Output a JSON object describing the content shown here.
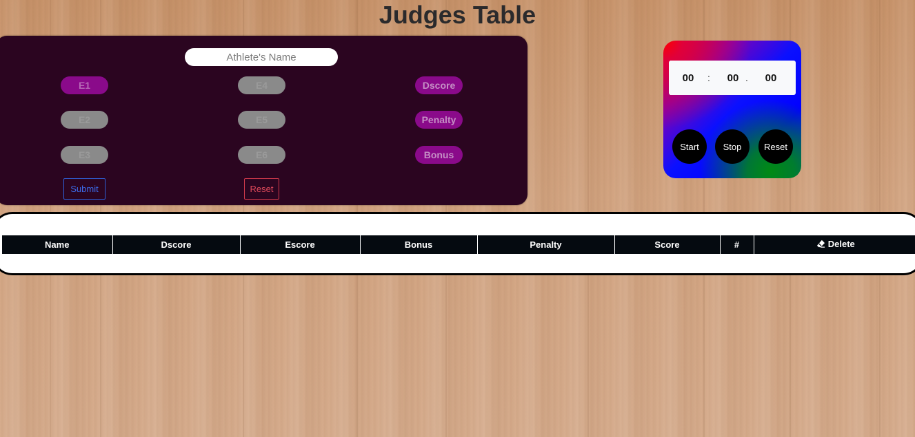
{
  "page": {
    "title": "Judges Table"
  },
  "judges_panel": {
    "athlete_name_placeholder": "Athlete's Name",
    "execution_scores": [
      {
        "label": "E1",
        "enabled": true
      },
      {
        "label": "E2",
        "enabled": false
      },
      {
        "label": "E3",
        "enabled": false
      },
      {
        "label": "E4",
        "enabled": false
      },
      {
        "label": "E5",
        "enabled": false
      },
      {
        "label": "E6",
        "enabled": false
      }
    ],
    "extra_scores": {
      "dscore": "Dscore",
      "penalty": "Penalty",
      "bonus": "Bonus"
    },
    "submit_label": "Submit",
    "reset_label": "Reset"
  },
  "timer": {
    "minutes": "00",
    "separator_1": ":",
    "seconds": "00",
    "separator_2": ".",
    "centiseconds": "00",
    "start_label": "Start",
    "stop_label": "Stop",
    "reset_label": "Reset"
  },
  "results_table": {
    "columns": [
      "Name",
      "Dscore",
      "Escore",
      "Bonus",
      "Penalty",
      "Score",
      "#",
      "Delete"
    ],
    "delete_icon": "eraser-icon",
    "rows": []
  },
  "colors": {
    "panel_bg": "#2b0520",
    "pill_active": "#8a0a8a",
    "pill_disabled": "#8a8a8a",
    "submit": "#2f5fd6",
    "reset": "#d43b4c",
    "table_header": "#050a10"
  }
}
